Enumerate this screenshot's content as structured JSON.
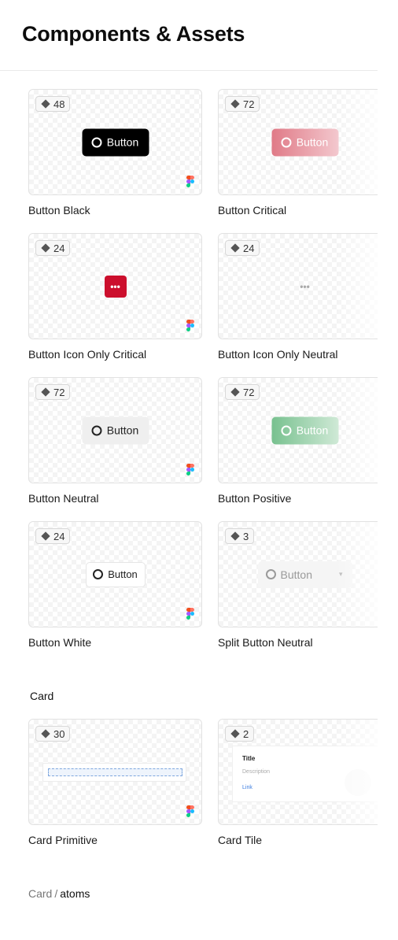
{
  "header": {
    "title": "Components & Assets"
  },
  "cards": [
    {
      "name": "Button Black",
      "count": "48",
      "button_label": "Button"
    },
    {
      "name": "Button Critical",
      "count": "72",
      "button_label": "Button"
    },
    {
      "name": "Button Icon Only Critical",
      "count": "24",
      "icon": "more-horizontal-icon"
    },
    {
      "name": "Button Icon Only Neutral",
      "count": "24",
      "icon": "more-horizontal-icon"
    },
    {
      "name": "Button Neutral",
      "count": "72",
      "button_label": "Button"
    },
    {
      "name": "Button Positive",
      "count": "72",
      "button_label": "Button"
    },
    {
      "name": "Button White",
      "count": "24",
      "button_label": "Button"
    },
    {
      "name": "Split Button Neutral",
      "count": "3",
      "button_label": "Button"
    },
    {
      "name": "Card Primitive",
      "count": "30"
    },
    {
      "name": "Card Tile",
      "count": "2",
      "tile_title": "Title",
      "tile_description": "Description",
      "tile_link": "Link"
    }
  ],
  "sections": {
    "card": "Card"
  },
  "breadcrumb": {
    "parent": "Card",
    "separator": "/",
    "current": "atoms"
  },
  "colors": {
    "black_button": "#000000",
    "critical": "#cc0f2d",
    "critical_button": "#e07a87",
    "positive_button": "#78c18f",
    "neutral_button": "#efefef"
  }
}
